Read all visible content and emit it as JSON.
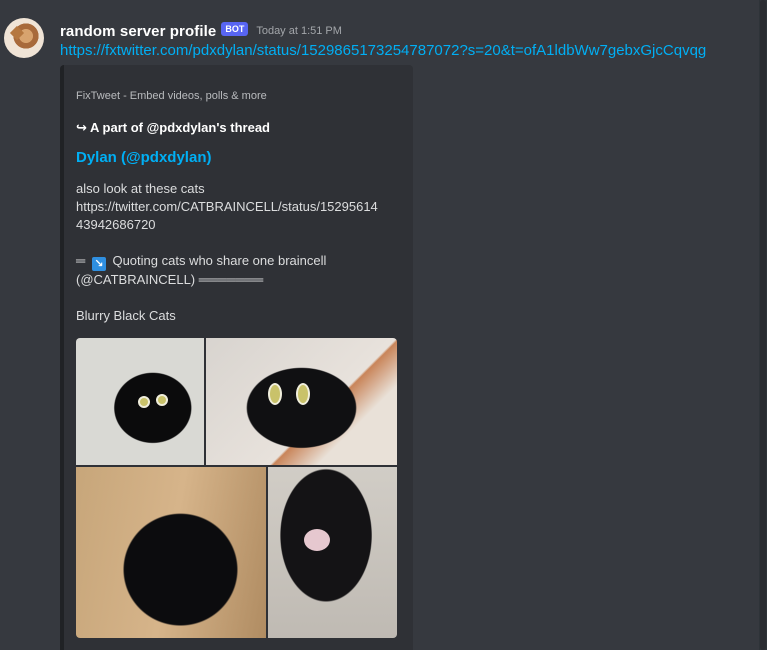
{
  "message": {
    "username": "random server profile",
    "bot_tag": "BOT",
    "timestamp": "Today at 1:51 PM",
    "link": "https://fxtwitter.com/pdxdylan/status/1529865173254787072?s=20&t=ofA1ldbWw7gebxGjcCqvqg"
  },
  "embed": {
    "provider": "FixTweet - Embed videos, polls & more",
    "author": "↪ A part of @pdxdylan's thread",
    "title": "Dylan (@pdxdylan)",
    "desc_line1": "also look at these cats",
    "desc_line2": "https://twitter.com/CATBRAINCELL/status/15295614",
    "desc_line3": "43942686720",
    "quote_prefix": "═",
    "quote_emoji": "↘",
    "quote_line1": "Quoting cats who share one braincell",
    "quote_line2": "(@CATBRAINCELL) ═══════",
    "desc_line4": "Blurry Black Cats"
  },
  "gallery": {
    "images": [
      "black-cat-photo-1",
      "black-cat-photo-2",
      "black-cat-photo-3",
      "black-cat-photo-4"
    ]
  },
  "colors": {
    "background": "#36393f",
    "embed_background": "#2f3136",
    "link": "#00aff4",
    "bot_tag": "#5865f2"
  }
}
